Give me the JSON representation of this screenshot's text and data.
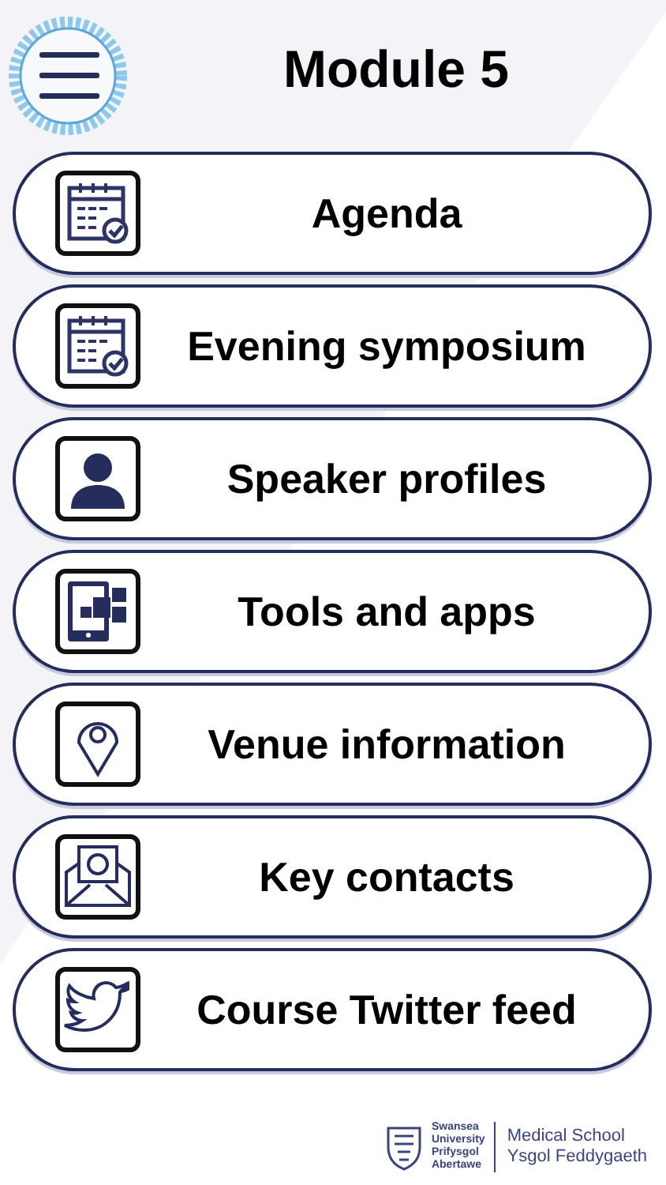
{
  "title": "Module 5",
  "items": [
    {
      "label": "Agenda",
      "kind": "calendar"
    },
    {
      "label": "Evening symposium",
      "kind": "calendar"
    },
    {
      "label": "Speaker profiles",
      "kind": "person"
    },
    {
      "label": "Tools and apps",
      "kind": "tablet"
    },
    {
      "label": "Venue information",
      "kind": "pin"
    },
    {
      "label": "Key contacts",
      "kind": "mail"
    },
    {
      "label": "Course Twitter feed",
      "kind": "bird"
    }
  ],
  "footer": {
    "university": [
      "Swansea",
      "University",
      "Prifysgol",
      "Abertawe"
    ],
    "school": [
      "Medical School",
      "Ysgol Feddygaeth"
    ]
  }
}
